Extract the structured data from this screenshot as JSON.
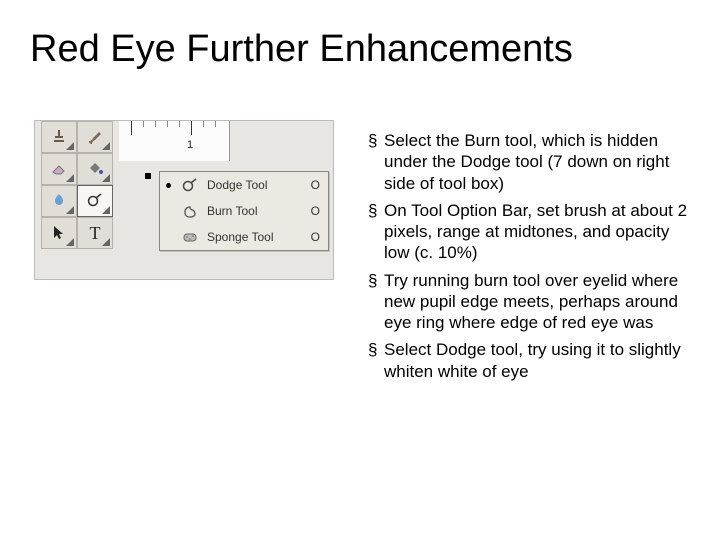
{
  "title": "Red Eye Further Enhancements",
  "ruler": {
    "bigTickLabel": "1"
  },
  "flyout": {
    "items": [
      {
        "label": "Dodge Tool",
        "shortcut": "O",
        "selected": true
      },
      {
        "label": "Burn Tool",
        "shortcut": "O",
        "selected": false
      },
      {
        "label": "Sponge Tool",
        "shortcut": "O",
        "selected": false
      }
    ]
  },
  "bullets": [
    "Select the Burn tool, which is hidden under the Dodge tool (7 down on right side of tool box)",
    "On Tool Option Bar, set brush at about 2 pixels, range at midtones, and opacity low (c. 10%)",
    "Try running burn tool over eyelid where new pupil edge meets, perhaps around eye ring where edge of red eye was",
    "Select Dodge tool, try using it to slightly whiten white of eye"
  ],
  "bulletMarker": "§"
}
